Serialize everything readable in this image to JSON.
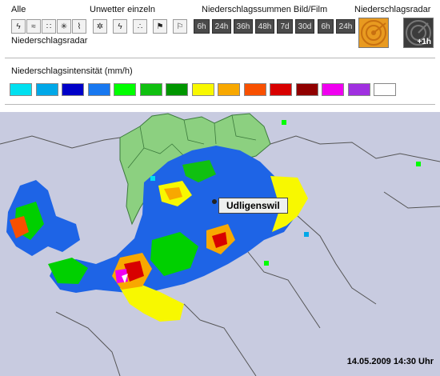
{
  "toolbar": {
    "alle_label": "Alle",
    "unwetter_label": "Unwetter einzeln",
    "summen_label": "Niederschlagssummen Bild/Film",
    "radar_label": "Niederschlagsradar",
    "radar_sub_label": "Niederschlagsradar",
    "radar_forecast_label": "+1h",
    "summen_buttons": [
      "6h",
      "24h",
      "36h",
      "48h",
      "7d",
      "30d"
    ],
    "film_buttons": [
      "6h",
      "24h"
    ]
  },
  "legend": {
    "title": "Niederschlagsintensität (mm/h)",
    "colors": [
      "#00e0f0",
      "#00a8e8",
      "#0000c8",
      "#1878f0",
      "#00ff00",
      "#10c010",
      "#009600",
      "#f8f800",
      "#f8a800",
      "#f85000",
      "#d80000",
      "#900000",
      "#f000f0",
      "#a030e0",
      "#ffffff"
    ]
  },
  "map": {
    "location_label": "Udligenswil",
    "timestamp": "14.05.2009 14:30 Uhr"
  }
}
